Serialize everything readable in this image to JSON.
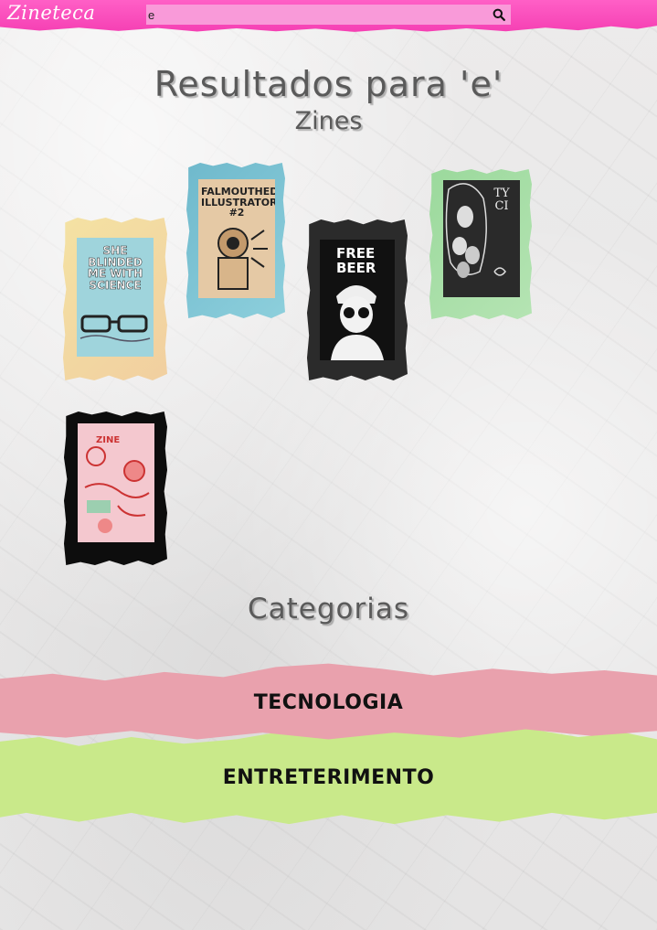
{
  "header": {
    "logo": "Zineteca",
    "search": {
      "value": "e",
      "placeholder": ""
    },
    "search_icon": "search-icon"
  },
  "results": {
    "title": "Resultados para 'e'",
    "subtitle": "Zines"
  },
  "zines": [
    {
      "cover_text": "SHE BLINDED ME WITH SCIENCE",
      "paper": "#f2dc9c",
      "cover_bg": "#9fd4dc"
    },
    {
      "cover_text": "FALMOUTHED ILLUSTRATORS #2",
      "paper": "#7cc3d3",
      "cover_bg": "#e5c9a5"
    },
    {
      "cover_text": "FREE BEER",
      "paper": "#2b2b2b",
      "cover_bg": "#111111"
    },
    {
      "cover_text": "TY CI",
      "paper": "#a6dca5",
      "cover_bg": "#2a2a2a"
    },
    {
      "cover_text": "ZINE",
      "paper": "#0d0d0d",
      "cover_bg": "#f4c8cf"
    }
  ],
  "categories": {
    "title": "Categorias",
    "items": [
      {
        "label": "TECNOLOGIA",
        "color": "#e9a1ad"
      },
      {
        "label": "ENTRETERIMENTO",
        "color": "#c9e98a"
      }
    ]
  }
}
